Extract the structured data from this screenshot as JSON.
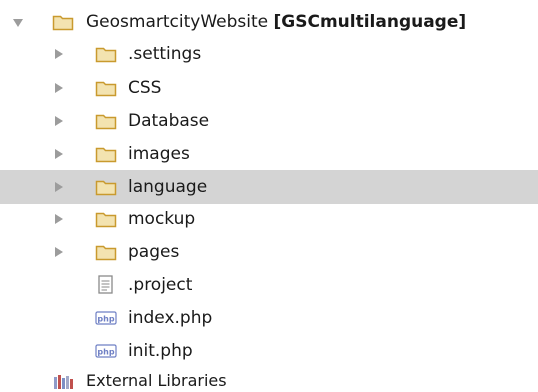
{
  "project_tree": {
    "root": {
      "name": "GeosmartcityWebsite",
      "module": "[GSCmultilanguage]"
    },
    "folders": [
      {
        "label": ".settings"
      },
      {
        "label": "CSS"
      },
      {
        "label": "Database"
      },
      {
        "label": "images"
      },
      {
        "label": "language",
        "selected": true
      },
      {
        "label": "mockup"
      },
      {
        "label": "pages"
      }
    ],
    "files": [
      {
        "label": ".project",
        "icon": "text-file-icon"
      },
      {
        "label": "index.php",
        "icon": "php-file-icon"
      },
      {
        "label": "init.php",
        "icon": "php-file-icon"
      }
    ],
    "external_libraries": "External Libraries"
  },
  "icons": {
    "php_badge": "php"
  },
  "colors": {
    "folder_fill": "#f3e3b0",
    "folder_stroke": "#c99a2e",
    "selection_bg": "#d4d4d4",
    "arrow": "#9c9c9c",
    "php_badge": "#6e7fc4"
  }
}
